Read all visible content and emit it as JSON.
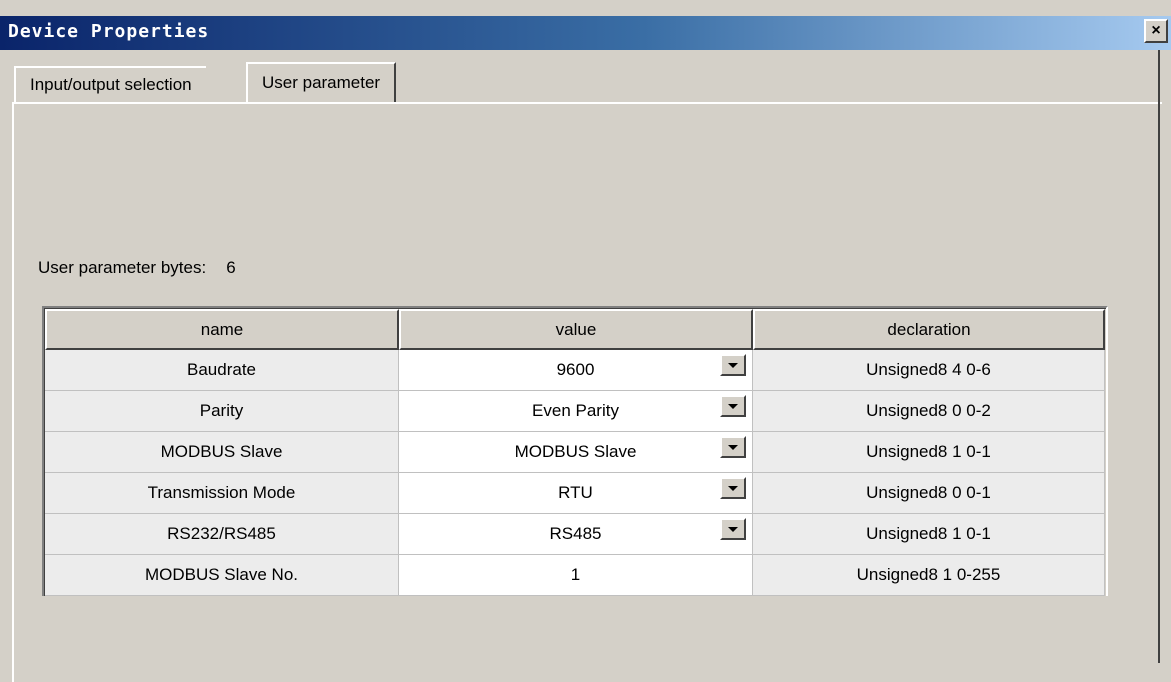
{
  "window": {
    "title": "Device Properties",
    "close_glyph": "×"
  },
  "tabs": [
    {
      "label": "Input/output selection",
      "active": false
    },
    {
      "label": "User parameter",
      "active": true
    }
  ],
  "user_parameter_bytes": {
    "label": "User parameter bytes:",
    "value": "6"
  },
  "table": {
    "columns": [
      "name",
      "value",
      "declaration"
    ],
    "rows": [
      {
        "name": "Baudrate",
        "value": "9600",
        "declaration": "Unsigned8 4 0-6",
        "dropdown": true
      },
      {
        "name": "Parity",
        "value": "Even Parity",
        "declaration": "Unsigned8 0 0-2",
        "dropdown": true
      },
      {
        "name": "MODBUS Slave",
        "value": "MODBUS Slave",
        "declaration": "Unsigned8 1 0-1",
        "dropdown": true
      },
      {
        "name": "Transmission Mode",
        "value": "RTU",
        "declaration": "Unsigned8 0 0-1",
        "dropdown": true
      },
      {
        "name": "RS232/RS485",
        "value": "RS485",
        "declaration": "Unsigned8 1 0-1",
        "dropdown": true
      },
      {
        "name": "MODBUS Slave No.",
        "value": "1",
        "declaration": "Unsigned8 1 0-255",
        "dropdown": false
      }
    ]
  },
  "icons": {
    "close": "close-icon",
    "dropdown": "chevron-down-icon"
  },
  "colors": {
    "title_gradient_start": "#0a246a",
    "title_gradient_end": "#a6caf0",
    "face": "#d4d0c8",
    "value_cell": "#ffffff",
    "other_cell": "#ececec"
  }
}
